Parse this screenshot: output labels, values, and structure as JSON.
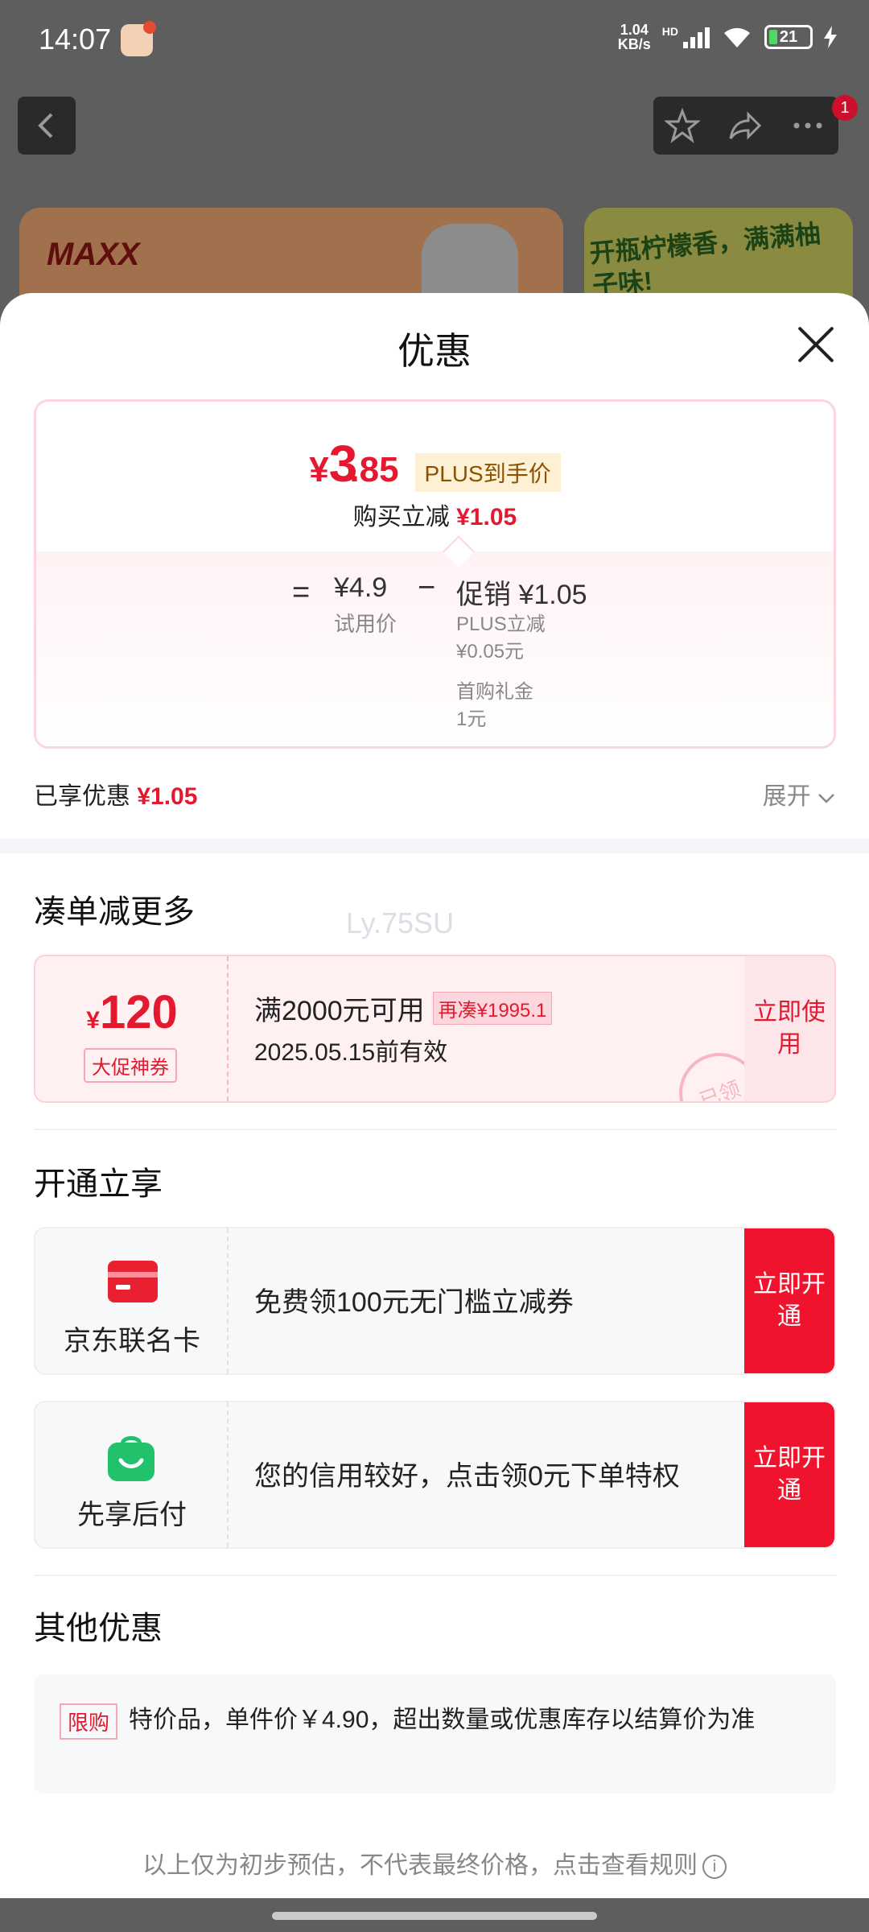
{
  "status_bar": {
    "time": "14:07",
    "net_speed_top": "1.04",
    "net_speed_unit": "KB/s",
    "hd": "HD",
    "battery": "21"
  },
  "page_header": {
    "badge_count": "1"
  },
  "background": {
    "banner1_text": "MAXX",
    "banner2_text": "开瓶柠檬香，满满柚子味!"
  },
  "sheet": {
    "title": "优惠"
  },
  "price_box": {
    "currency": "¥",
    "price_int": "3",
    "price_dec": ".85",
    "plus_tag": "PLUS到手价",
    "subtitle_prefix": "购买立减",
    "subtitle_amount": "¥1.05",
    "eq": "=",
    "base_price": "¥4.9",
    "base_label": "试用价",
    "minus": "−",
    "promo": "促销 ¥1.05",
    "details": [
      "PLUS立减",
      "¥0.05元",
      "首购礼金",
      "1元"
    ]
  },
  "enjoyed": {
    "label": "已享优惠",
    "amount": "¥1.05",
    "expand": "展开"
  },
  "watermark": "Ly.75SU",
  "section1": {
    "title": "凑单减更多",
    "coupon": {
      "currency": "¥",
      "amount": "120",
      "tag": "大促神券",
      "condition": "满2000元可用",
      "more": "再凑¥1995.1",
      "expiry": "2025.05.15前有效",
      "button": "立即使用",
      "stamp": "已领"
    }
  },
  "section2": {
    "title": "开通立享",
    "offers": [
      {
        "name": "京东联名卡",
        "text": "免费领100元无门槛立减券",
        "button": "立即开通"
      },
      {
        "name": "先享后付",
        "text": "您的信用较好，点击领0元下单特权",
        "button": "立即开通"
      }
    ]
  },
  "section3": {
    "title": "其他优惠",
    "tag": "限购",
    "text": "特价品，单件价￥4.90，超出数量或优惠库存以结算价为准"
  },
  "footer": {
    "text": "以上仅为初步预估，不代表最终价格，点击查看规则",
    "info": "i"
  },
  "colors": {
    "accent_red": "#e4182e",
    "button_red": "#f0132d"
  }
}
